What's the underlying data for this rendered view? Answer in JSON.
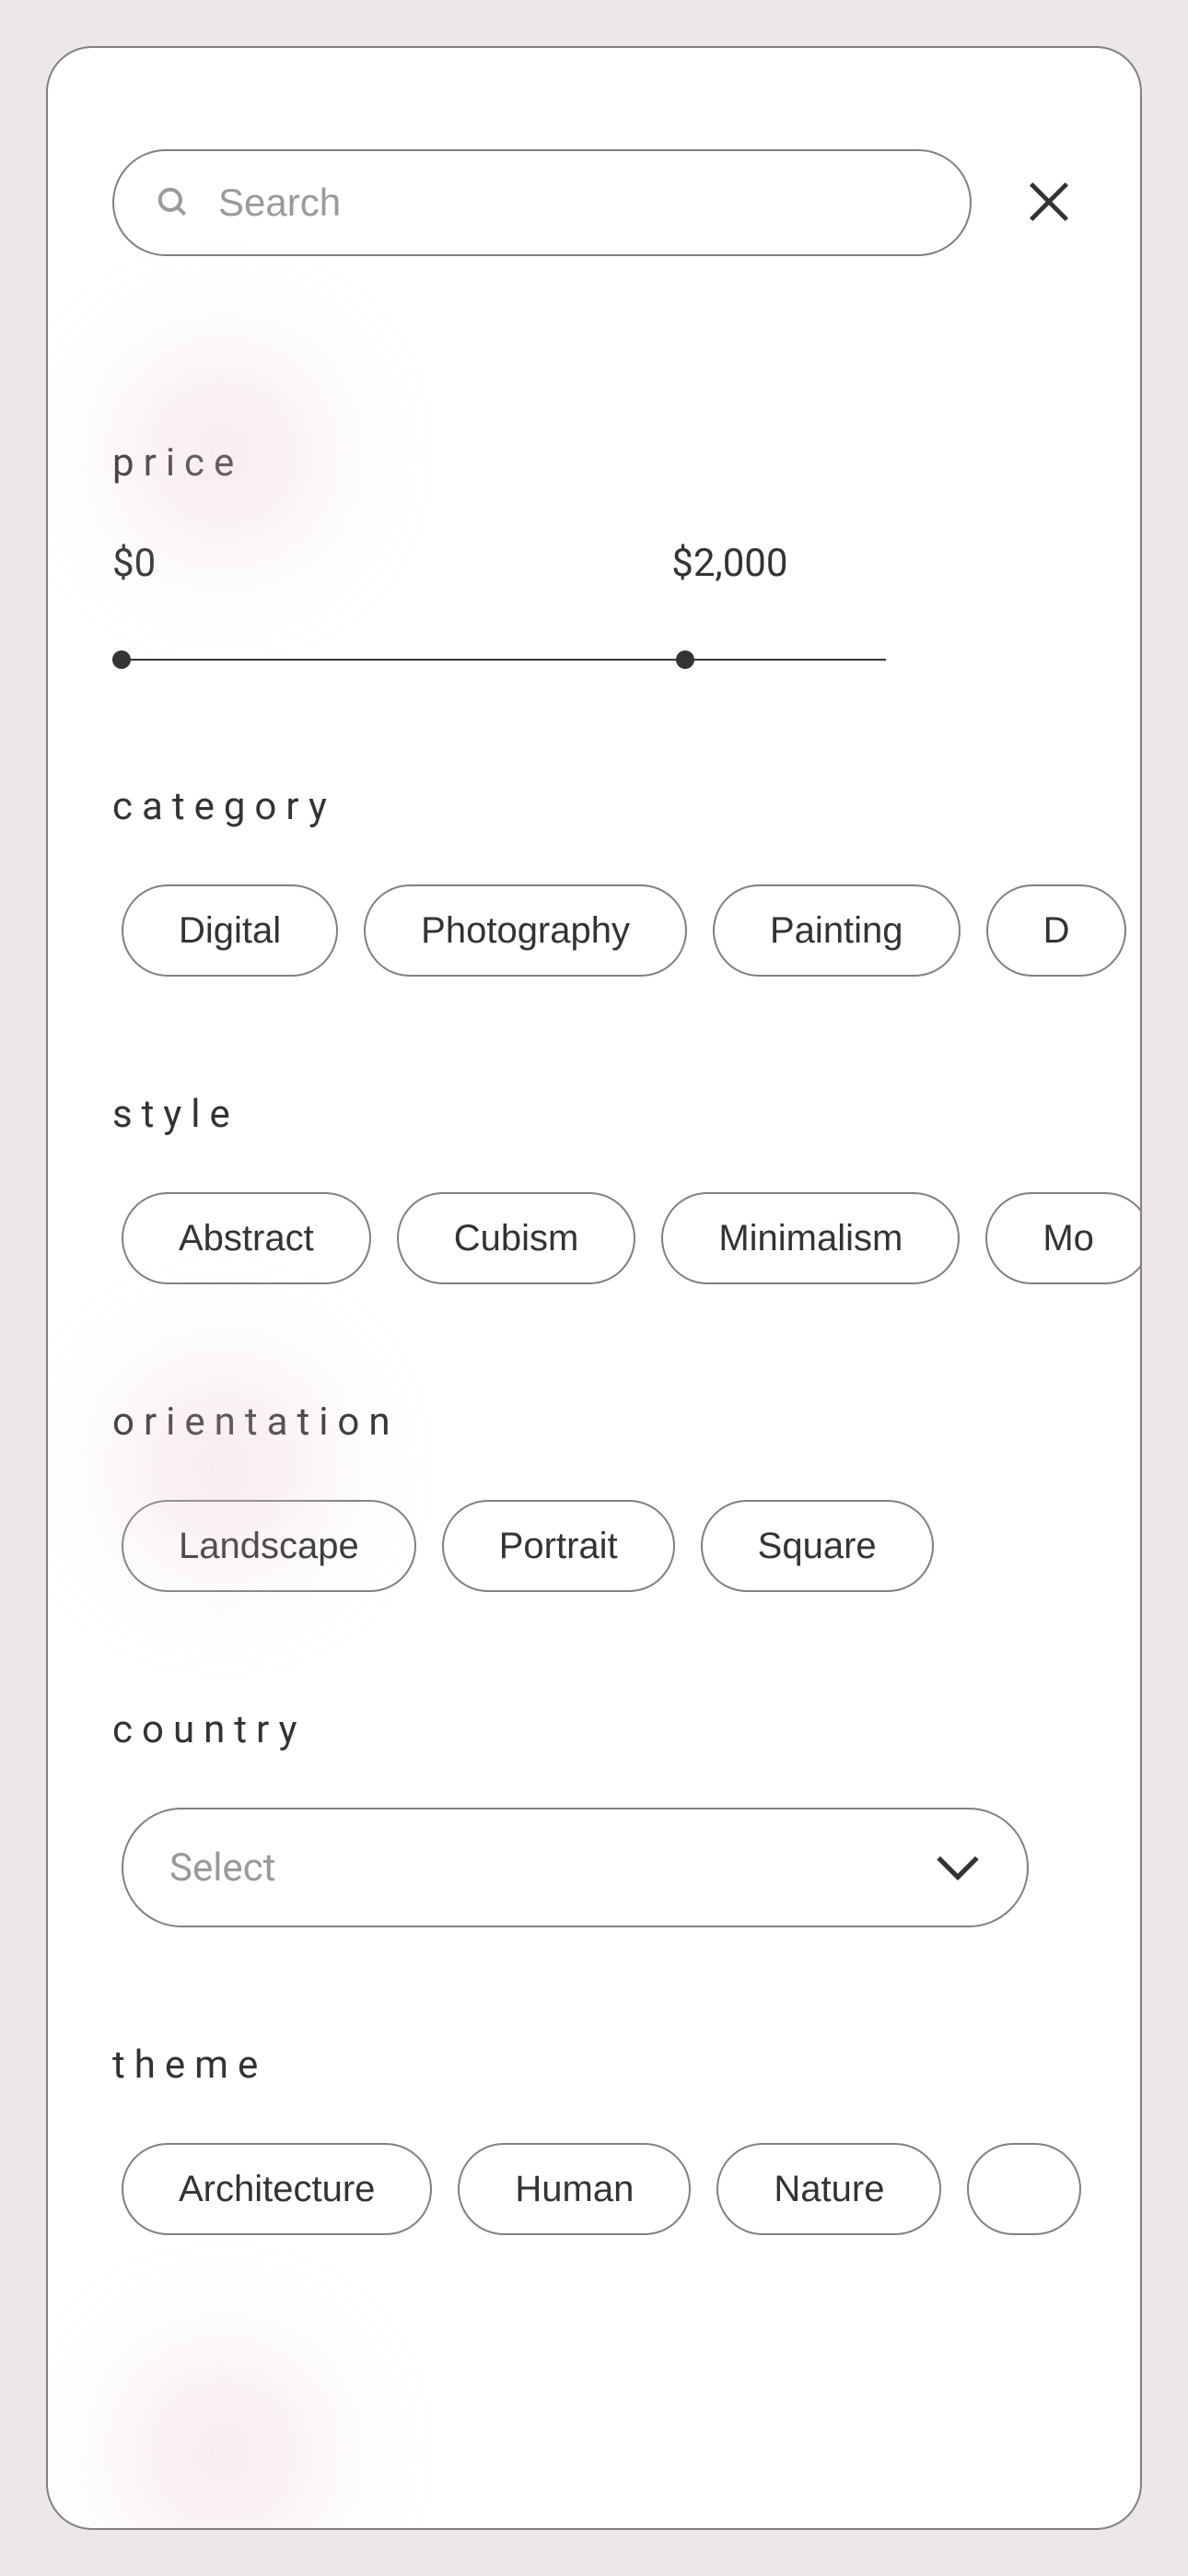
{
  "header": {
    "search_placeholder": "Search"
  },
  "sections": {
    "price": {
      "label": "price",
      "min": "$0",
      "max": "$2,000"
    },
    "category": {
      "label": "category",
      "options": [
        "Digital",
        "Photography",
        "Painting",
        "D"
      ]
    },
    "style": {
      "label": "style",
      "options": [
        "Abstract",
        "Cubism",
        "Minimalism",
        "Mo"
      ]
    },
    "orientation": {
      "label": "orientation",
      "options": [
        "Landscape",
        "Portrait",
        "Square"
      ]
    },
    "country": {
      "label": "country",
      "placeholder": "Select"
    },
    "theme": {
      "label": "theme",
      "options": [
        "Architecture",
        "Human",
        "Nature",
        ""
      ]
    }
  }
}
